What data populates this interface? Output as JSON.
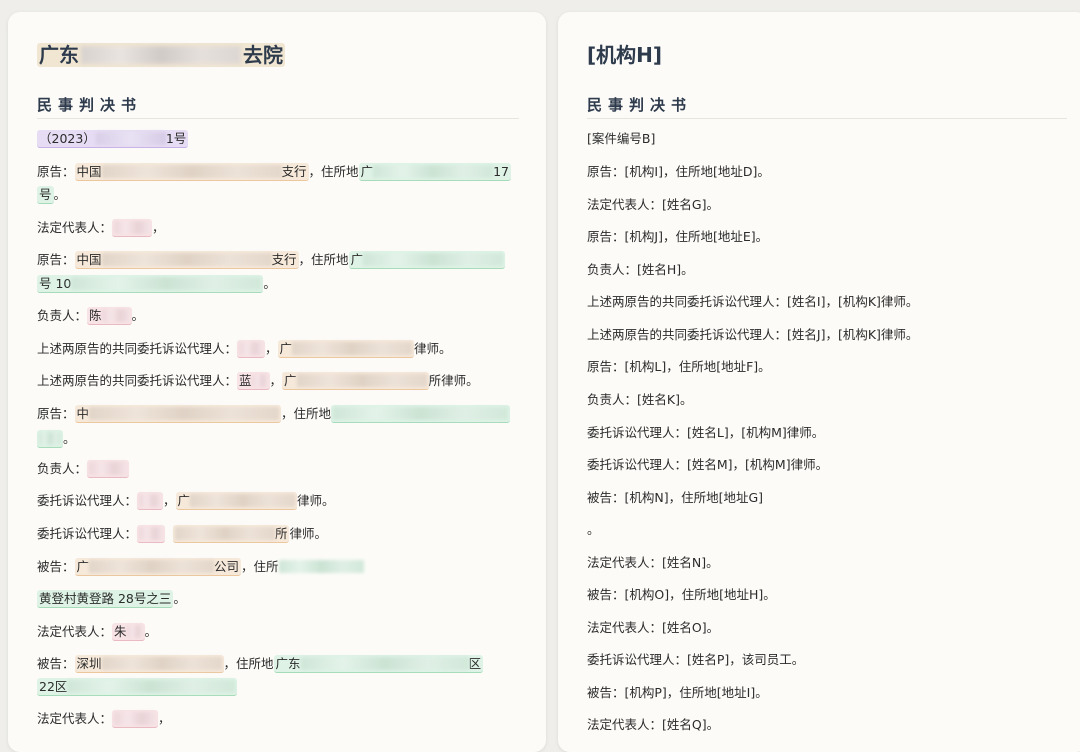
{
  "left": {
    "title_start": "广东",
    "title_end": "去院",
    "subtitle": "民事判决书",
    "case_prefix": "（2023）",
    "case_suffix": "1号",
    "lines": {
      "l1a": "原告：",
      "l1b": "中国",
      "l1c": "支行",
      "l1d": "，住所地",
      "l1e": "广",
      "l1f": "17",
      "l1g": "号",
      "l1h": "。",
      "l2a": "法定代表人：",
      "l2b": "，",
      "l3a": "原告：",
      "l3b": "中国",
      "l3c": "支行",
      "l3d": "，住所地",
      "l3e": "广",
      "l3f": "号 10",
      "l3g": "。",
      "l4a": "负责人：",
      "l4b": "陈",
      "l4c": "。",
      "l5a": "上述两原告的共同委托诉讼代理人：",
      "l5b": "，",
      "l5c": "广",
      "l5d": "律师。",
      "l6a": "上述两原告的共同委托诉讼代理人：",
      "l6b": "蓝",
      "l6c": "，",
      "l6d": "广",
      "l6e": "所",
      "l6f": "律师。",
      "l7a": "原告：",
      "l7b": "中",
      "l7c": "，住所地",
      "l7d": "。",
      "l8a": "负责人：",
      "l9a": "委托诉讼代理人：",
      "l9b": "，",
      "l9c": "广",
      "l9d": "律师。",
      "l10a": "委托诉讼代理人：",
      "l10b": "所",
      "l10c": "律师。",
      "l11a": "被告：",
      "l11b": "广",
      "l11c": "公司",
      "l11d": "，住所",
      "l12a": "黄登村黄登路 28号之三",
      "l12b": "。",
      "l13a": "法定代表人：",
      "l13b": "朱",
      "l13c": "。",
      "l14a": "被告：",
      "l14b": "深圳",
      "l14c": "，住所地",
      "l14d": "广东",
      "l14e": "区",
      "l15a": "22区",
      "l16a": "法定代表人：",
      "l16b": "，"
    }
  },
  "right": {
    "title": "[机构H]",
    "subtitle": "民事判决书",
    "lines": [
      "[案件编号B]",
      "原告：[机构I]，住所地[地址D]。",
      "法定代表人：[姓名G]。",
      "原告：[机构J]，住所地[地址E]。",
      "负责人：[姓名H]。",
      "上述两原告的共同委托诉讼代理人：[姓名I]，[机构K]律师。",
      "上述两原告的共同委托诉讼代理人：[姓名J]，[机构K]律师。",
      "原告：[机构L]，住所地[地址F]。",
      "负责人：[姓名K]。",
      "委托诉讼代理人：[姓名L]，[机构M]律师。",
      "委托诉讼代理人：[姓名M]，[机构M]律师。",
      "被告：[机构N]，住所地[地址G]",
      "。",
      "法定代表人：[姓名N]。",
      "被告：[机构O]，住所地[地址H]。",
      "法定代表人：[姓名O]。",
      "委托诉讼代理人：[姓名P]，该司员工。",
      "被告：[机构P]，住所地[地址I]。",
      "法定代表人：[姓名Q]。"
    ]
  }
}
